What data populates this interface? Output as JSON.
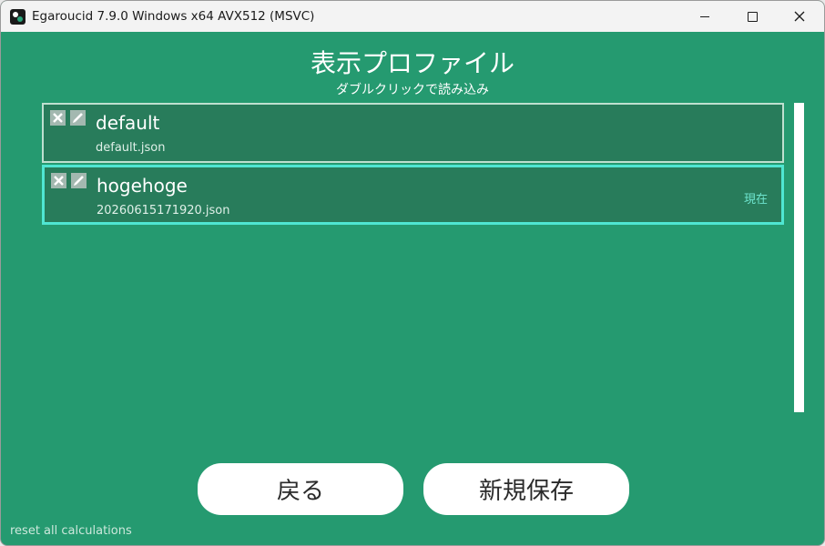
{
  "window": {
    "title": "Egaroucid 7.9.0 Windows x64 AVX512 (MSVC)"
  },
  "header": {
    "title": "表示プロファイル",
    "subtitle": "ダブルクリックで読み込み"
  },
  "profiles": [
    {
      "name": "default",
      "file": "default.json",
      "current": false,
      "badge": ""
    },
    {
      "name": "hogehoge",
      "file": "20260615171920.json",
      "current": true,
      "badge": "現在"
    }
  ],
  "buttons": {
    "back": "戻る",
    "save_new": "新規保存"
  },
  "footer": {
    "reset_label": "reset all calculations"
  },
  "icons": {
    "delete": "close-x-icon",
    "edit": "pencil-icon"
  },
  "colors": {
    "background": "#259a70",
    "card": "#287c5b",
    "current_border": "#4fe6d2"
  }
}
